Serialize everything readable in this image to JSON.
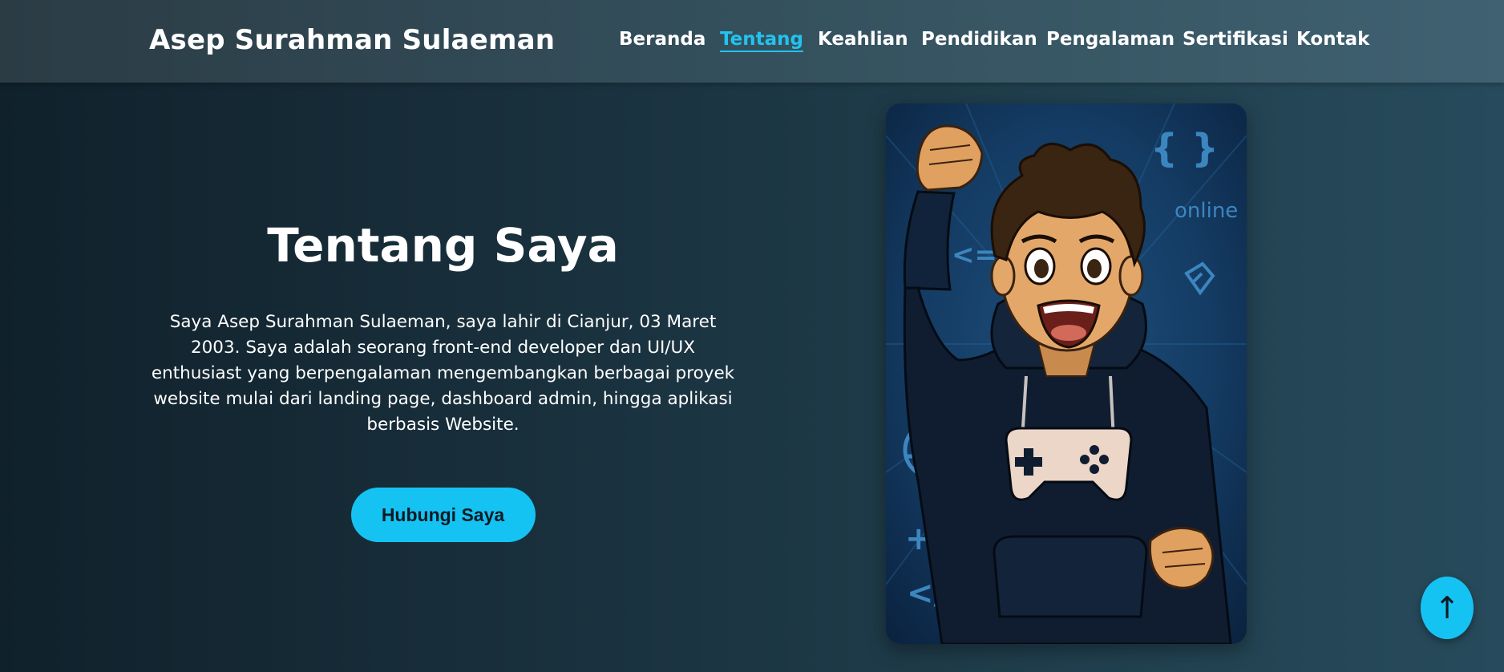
{
  "header": {
    "brand": "Asep Surahman Sulaeman",
    "nav": [
      {
        "label": "Beranda",
        "active": false
      },
      {
        "label": "Tentang",
        "active": true
      },
      {
        "label": "Keahlian",
        "active": false
      },
      {
        "label": "Pendidikan",
        "active": false
      },
      {
        "label": "Pengalaman",
        "active": false
      },
      {
        "label": "Sertifikasi",
        "active": false
      },
      {
        "label": "Kontak",
        "active": false
      }
    ]
  },
  "hero": {
    "title": "Tentang Saya",
    "description": "Saya Asep Surahman Sulaeman, saya lahir di Cianjur, 03 Maret 2003. Saya adalah seorang front-end developer dan UI/UX enthusiast yang berpengalaman mengembangkan berbagai proyek website mulai dari landing page, dashboard admin, hingga aplikasi berbasis Website.",
    "cta_label": "Hubungi Saya"
  },
  "portrait": {
    "icons": [
      "code-braces-icon",
      "less-equal-icon",
      "online-text",
      "pen-tool-icon",
      "running-person-icon",
      "plus-icon",
      "code-tag-icon"
    ],
    "text_online": "online",
    "text_braces": "{ }",
    "text_le": "<=",
    "text_tag": "</>",
    "text_plus": "+"
  },
  "scroll_top": {
    "label": "↑"
  },
  "colors": {
    "accent": "#15c3f3",
    "nav_active": "#22c3ee",
    "bg_dark": "#10212b",
    "bg_light": "#274b5c"
  }
}
